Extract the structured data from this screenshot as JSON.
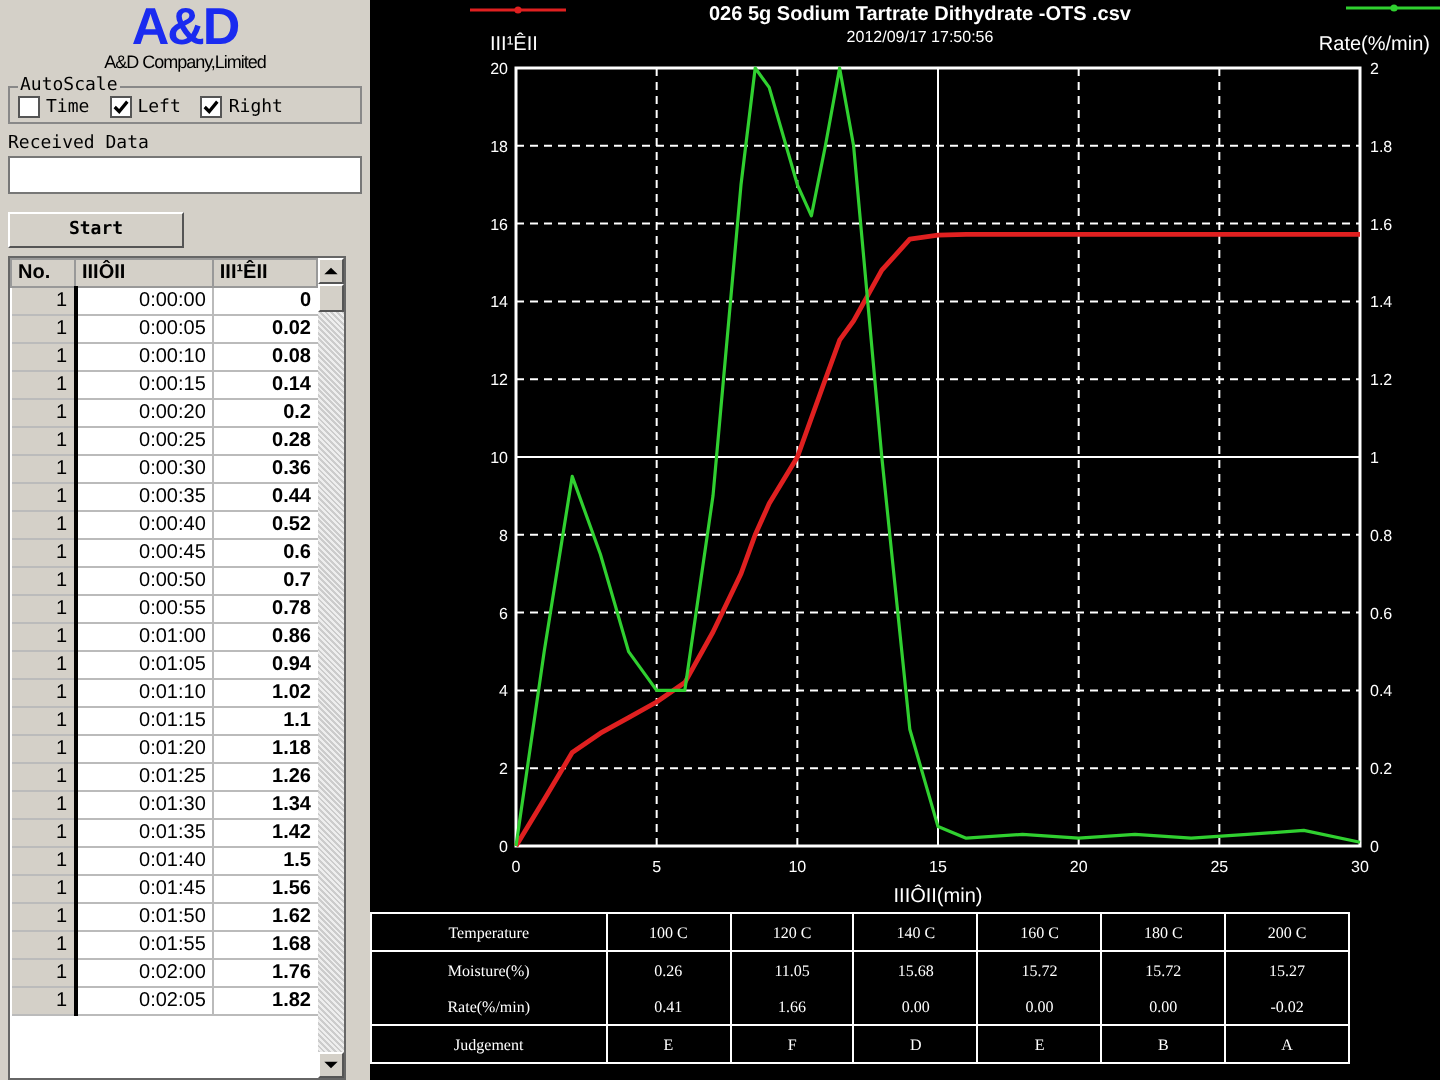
{
  "logo": {
    "mark": "A&D",
    "company": "A&D Company,Limited"
  },
  "autoscale": {
    "title": "AutoScale",
    "options": [
      {
        "label": "Time",
        "checked": false
      },
      {
        "label": "Left",
        "checked": true
      },
      {
        "label": "Right",
        "checked": true
      }
    ]
  },
  "received_data": {
    "label": "Received Data"
  },
  "start_button": "Start",
  "data_table": {
    "columns": [
      "No.",
      "IIIÔII",
      "III¹ÊII"
    ],
    "rows": [
      [
        "1",
        "0:00:00",
        "0"
      ],
      [
        "1",
        "0:00:05",
        "0.02"
      ],
      [
        "1",
        "0:00:10",
        "0.08"
      ],
      [
        "1",
        "0:00:15",
        "0.14"
      ],
      [
        "1",
        "0:00:20",
        "0.2"
      ],
      [
        "1",
        "0:00:25",
        "0.28"
      ],
      [
        "1",
        "0:00:30",
        "0.36"
      ],
      [
        "1",
        "0:00:35",
        "0.44"
      ],
      [
        "1",
        "0:00:40",
        "0.52"
      ],
      [
        "1",
        "0:00:45",
        "0.6"
      ],
      [
        "1",
        "0:00:50",
        "0.7"
      ],
      [
        "1",
        "0:00:55",
        "0.78"
      ],
      [
        "1",
        "0:01:00",
        "0.86"
      ],
      [
        "1",
        "0:01:05",
        "0.94"
      ],
      [
        "1",
        "0:01:10",
        "1.02"
      ],
      [
        "1",
        "0:01:15",
        "1.1"
      ],
      [
        "1",
        "0:01:20",
        "1.18"
      ],
      [
        "1",
        "0:01:25",
        "1.26"
      ],
      [
        "1",
        "0:01:30",
        "1.34"
      ],
      [
        "1",
        "0:01:35",
        "1.42"
      ],
      [
        "1",
        "0:01:40",
        "1.5"
      ],
      [
        "1",
        "0:01:45",
        "1.56"
      ],
      [
        "1",
        "0:01:50",
        "1.62"
      ],
      [
        "1",
        "0:01:55",
        "1.68"
      ],
      [
        "1",
        "0:02:00",
        "1.76"
      ],
      [
        "1",
        "0:02:05",
        "1.82"
      ]
    ]
  },
  "chart": {
    "subtitle": "2012/09/17 17:50:56",
    "chart_data": {
      "type": "line",
      "title": "026 5g Sodium Tartrate Dithydrate -OTS .csv",
      "xlabel": "IIIÔII(min)",
      "ylabel": "III¹ÊII",
      "x": [
        0,
        1,
        2,
        3,
        4,
        5,
        6,
        7,
        8,
        8.5,
        9,
        10,
        10.5,
        11,
        11.5,
        12,
        13,
        14,
        15,
        16,
        18,
        20,
        22,
        24,
        26,
        28,
        30
      ],
      "y2label": "Rate(%/min)",
      "y2lim": [
        0,
        2
      ],
      "y2ticks": [
        0,
        0.2,
        0.4,
        0.6,
        0.8,
        1,
        1.2,
        1.4,
        1.6,
        1.8,
        2
      ],
      "grid": true,
      "xlim": [
        0,
        30
      ],
      "ylim": [
        0,
        20
      ],
      "xticks": [
        0,
        5,
        10,
        15,
        20,
        25,
        30
      ],
      "yticks": [
        0,
        2,
        4,
        6,
        8,
        10,
        12,
        14,
        16,
        18,
        20
      ],
      "series": [
        {
          "color": "#e02020",
          "values": [
            0,
            1.2,
            2.4,
            2.9,
            3.3,
            3.7,
            4.2,
            5.5,
            7,
            8,
            8.8,
            10,
            11,
            12,
            13,
            13.5,
            14.8,
            15.6,
            15.7,
            15.72,
            15.72,
            15.72,
            15.72,
            15.72,
            15.72,
            15.72,
            15.72
          ]
        },
        {
          "color": "#30d030",
          "axis": "y2",
          "values": [
            0,
            0.5,
            0.95,
            0.75,
            0.5,
            0.4,
            0.4,
            0.9,
            1.7,
            2.0,
            1.95,
            1.7,
            1.62,
            1.8,
            2.0,
            1.8,
            1.0,
            0.3,
            0.05,
            0.02,
            0.03,
            0.02,
            0.03,
            0.02,
            0.03,
            0.04,
            0.01
          ]
        }
      ]
    }
  },
  "results": {
    "rows": [
      [
        "Temperature",
        "100 C",
        "120 C",
        "140 C",
        "160 C",
        "180 C",
        "200 C"
      ],
      [
        "Moisture(%)",
        "0.26",
        "11.05",
        "15.68",
        "15.72",
        "15.72",
        "15.27"
      ],
      [
        "Rate(%/min)",
        "0.41",
        "1.66",
        "0.00",
        "0.00",
        "0.00",
        "-0.02"
      ],
      [
        "Judgement",
        "E",
        "F",
        "D",
        "E",
        "B",
        "A"
      ]
    ]
  }
}
